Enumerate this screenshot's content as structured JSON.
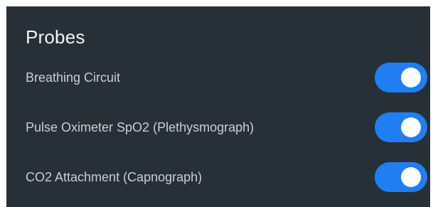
{
  "colors": {
    "panel_bg": "#263036",
    "title_text": "#f2f4f5",
    "label_text": "#c9cfd3",
    "toggle_on": "#1f7ff2",
    "knob": "#ffffff"
  },
  "panel": {
    "title": "Probes",
    "items": [
      {
        "label": "Breathing Circuit",
        "enabled": true
      },
      {
        "label": "Pulse Oximeter SpO2 (Plethysmograph)",
        "enabled": true
      },
      {
        "label": "CO2 Attachment (Capnograph)",
        "enabled": true
      }
    ]
  }
}
